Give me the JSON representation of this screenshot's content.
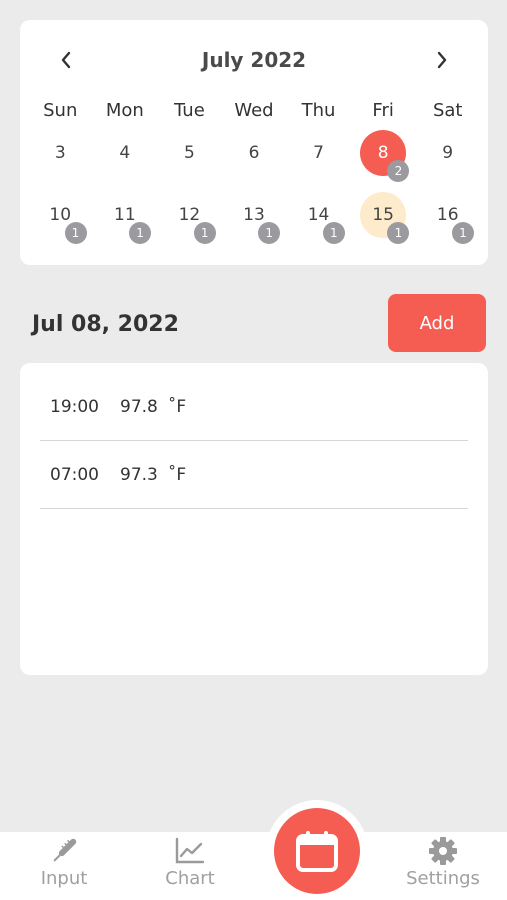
{
  "calendar": {
    "month_title": "July 2022",
    "prev_icon": "chevron-left-icon",
    "next_icon": "chevron-right-icon",
    "weekdays": [
      "Sun",
      "Mon",
      "Tue",
      "Wed",
      "Thu",
      "Fri",
      "Sat"
    ],
    "week1": [
      {
        "day": "3",
        "badge": ""
      },
      {
        "day": "4",
        "badge": ""
      },
      {
        "day": "5",
        "badge": ""
      },
      {
        "day": "6",
        "badge": ""
      },
      {
        "day": "7",
        "badge": ""
      },
      {
        "day": "8",
        "badge": "2"
      },
      {
        "day": "9",
        "badge": ""
      }
    ],
    "week2": [
      {
        "day": "10",
        "badge": "1"
      },
      {
        "day": "11",
        "badge": "1"
      },
      {
        "day": "12",
        "badge": "1"
      },
      {
        "day": "13",
        "badge": "1"
      },
      {
        "day": "14",
        "badge": "1"
      },
      {
        "day": "15",
        "badge": "1"
      },
      {
        "day": "16",
        "badge": "1"
      }
    ],
    "selected_color": "#f55d52",
    "today_color": "#fdebcb"
  },
  "detail": {
    "date_title": "Jul 08, 2022",
    "add_label": "Add",
    "records": [
      {
        "time": "19:00",
        "value": "97.8",
        "unit": "˚F"
      },
      {
        "time": "07:00",
        "value": "97.3",
        "unit": "˚F"
      }
    ]
  },
  "nav": {
    "input_label": "Input",
    "chart_label": "Chart",
    "settings_label": "Settings",
    "input_icon": "thermometer-icon",
    "chart_icon": "line-chart-icon",
    "calendar_icon": "calendar-icon",
    "settings_icon": "gear-icon",
    "accent": "#f55d52"
  }
}
